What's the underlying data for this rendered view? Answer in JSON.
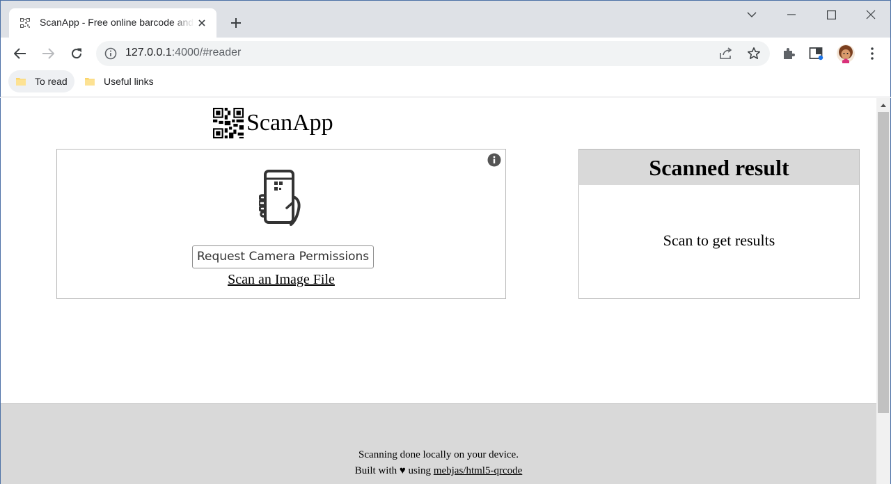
{
  "browser": {
    "tab_title": "ScanApp - Free online barcode and QR code scanner",
    "url_host": "127.0.0.1",
    "url_rest": ":4000/#reader",
    "bookmarks": [
      {
        "label": "To read"
      },
      {
        "label": "Useful links"
      }
    ]
  },
  "page": {
    "app_name": "ScanApp",
    "reader": {
      "camera_button_label": "Request Camera Permissions",
      "scan_file_link": "Scan an Image File"
    },
    "result": {
      "heading": "Scanned result",
      "placeholder": "Scan to get results"
    },
    "footer": {
      "line1": "Scanning done locally on your device.",
      "line2_prefix": "Built with ♥ using",
      "link_text": "mebjas/html5-qrcode"
    }
  },
  "colors": {
    "chrome_tabstrip": "#dee1e6",
    "omnibox": "#f1f3f4",
    "result_header": "#d9d9d9",
    "footer": "#d9d9d9"
  }
}
